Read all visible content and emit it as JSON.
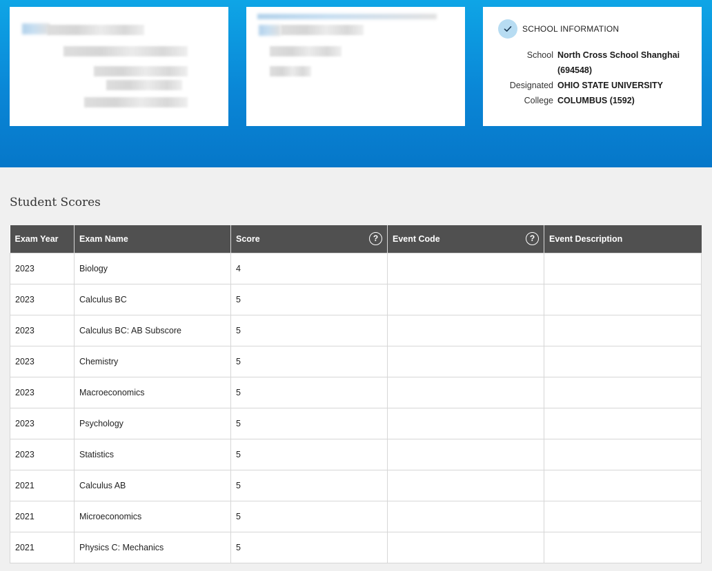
{
  "school_info": {
    "heading": "SCHOOL INFORMATION",
    "school_label": "School",
    "school_name": "North Cross School Shanghai",
    "school_code": "(694548)",
    "designated_label": "Designated",
    "college_label": "College",
    "college_name": "OHIO STATE UNIVERSITY",
    "college_city": "COLUMBUS (1592)"
  },
  "scores": {
    "title": "Student Scores",
    "columns": [
      "Exam Year",
      "Exam Name",
      "Score",
      "Event Code",
      "Event Description"
    ],
    "help_glyph": "?",
    "rows": [
      {
        "year": "2023",
        "exam": "Biology",
        "score": "4",
        "event_code": "",
        "event_desc": ""
      },
      {
        "year": "2023",
        "exam": "Calculus BC",
        "score": "5",
        "event_code": "",
        "event_desc": ""
      },
      {
        "year": "2023",
        "exam": "Calculus BC: AB Subscore",
        "score": "5",
        "event_code": "",
        "event_desc": ""
      },
      {
        "year": "2023",
        "exam": "Chemistry",
        "score": "5",
        "event_code": "",
        "event_desc": ""
      },
      {
        "year": "2023",
        "exam": "Macroeconomics",
        "score": "5",
        "event_code": "",
        "event_desc": ""
      },
      {
        "year": "2023",
        "exam": "Psychology",
        "score": "5",
        "event_code": "",
        "event_desc": ""
      },
      {
        "year": "2023",
        "exam": "Statistics",
        "score": "5",
        "event_code": "",
        "event_desc": ""
      },
      {
        "year": "2021",
        "exam": "Calculus AB",
        "score": "5",
        "event_code": "",
        "event_desc": ""
      },
      {
        "year": "2021",
        "exam": "Microeconomics",
        "score": "5",
        "event_code": "",
        "event_desc": ""
      },
      {
        "year": "2021",
        "exam": "Physics C: Mechanics",
        "score": "5",
        "event_code": "",
        "event_desc": ""
      }
    ]
  },
  "colors": {
    "header_blue": "#0a86d6",
    "table_header": "#505050",
    "check_circle": "#b7dcf2"
  },
  "icons": {
    "check": "check-icon",
    "help": "help-circle-icon"
  }
}
